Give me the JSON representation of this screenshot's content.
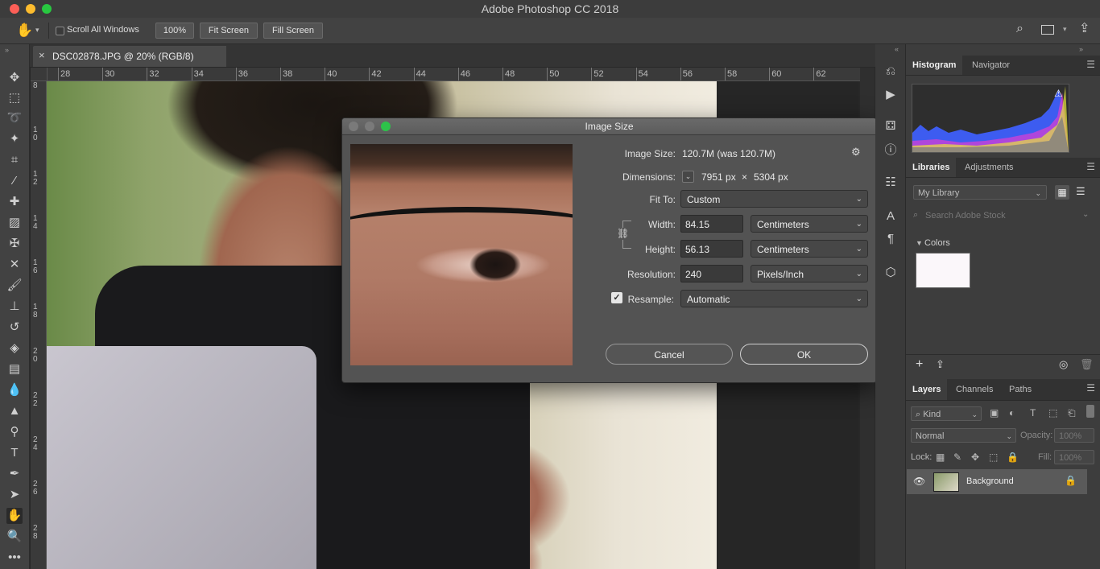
{
  "app": {
    "title": "Adobe Photoshop CC 2018"
  },
  "options": {
    "scroll_all_windows": "Scroll All Windows",
    "zoom_100": "100%",
    "fit_screen": "Fit Screen",
    "fill_screen": "Fill Screen"
  },
  "document": {
    "tab_label": "DSC02878.JPG @ 20% (RGB/8)",
    "close_glyph": "×"
  },
  "rulers": {
    "horizontal": [
      "28",
      "30",
      "32",
      "34",
      "36",
      "38",
      "40",
      "42",
      "44",
      "46",
      "48",
      "50",
      "52",
      "54",
      "56",
      "58",
      "60",
      "62"
    ],
    "vertical": [
      "8",
      "1 0",
      "1 2",
      "1 4",
      "1 6",
      "1 8",
      "2 0",
      "2 2",
      "2 4",
      "2 6",
      "2 8"
    ]
  },
  "dialog": {
    "title": "Image Size",
    "image_size_label": "Image Size:",
    "image_size_value": "120.7M (was 120.7M)",
    "dimensions_label": "Dimensions:",
    "dim_width": "7951 px",
    "dim_times": "×",
    "dim_height": "5304 px",
    "fit_to_label": "Fit To:",
    "fit_to_value": "Custom",
    "width_label": "Width:",
    "width_value": "84.15",
    "width_unit": "Centimeters",
    "height_label": "Height:",
    "height_value": "56.13",
    "height_unit": "Centimeters",
    "resolution_label": "Resolution:",
    "resolution_value": "240",
    "resolution_unit": "Pixels/Inch",
    "resample_label": "Resample:",
    "resample_value": "Automatic",
    "cancel": "Cancel",
    "ok": "OK"
  },
  "panels": {
    "histogram_tab": "Histogram",
    "navigator_tab": "Navigator",
    "libraries_tab": "Libraries",
    "adjustments_tab": "Adjustments",
    "library_select": "My Library",
    "search_placeholder": "Search Adobe Stock",
    "colors_label": "Colors",
    "layers_tab": "Layers",
    "channels_tab": "Channels",
    "paths_tab": "Paths",
    "kind_filter": "Kind",
    "blend_mode": "Normal",
    "opacity_label": "Opacity:",
    "opacity_value": "100%",
    "lock_label": "Lock:",
    "fill_label": "Fill:",
    "fill_value": "100%",
    "layer_name": "Background"
  },
  "colors": {
    "accent": "#3d7bd9",
    "panel": "#3d3d3d",
    "dialog": "#535353"
  }
}
